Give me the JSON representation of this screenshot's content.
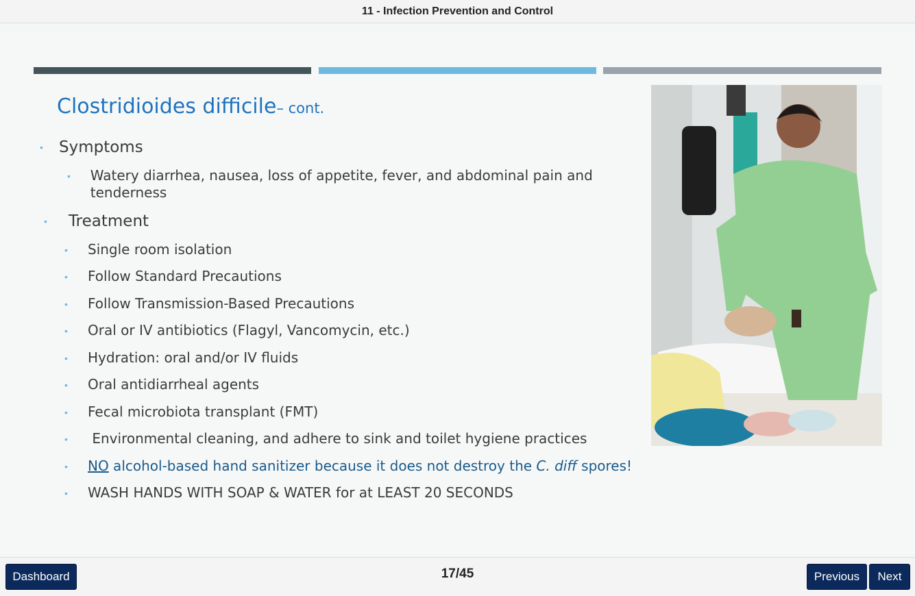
{
  "header": {
    "title": "11 - Infection Prevention and Control"
  },
  "slide": {
    "title": "Clostridioides difficile",
    "title_suffix": "– cont.",
    "sections": [
      {
        "label": "Symptoms",
        "items": [
          "Watery diarrhea, nausea, loss of appetite, fever, and abdominal pain and tenderness"
        ]
      },
      {
        "label": "Treatment",
        "items": [
          "Single room isolation",
          "Follow Standard Precautions",
          "Follow Transmission-Based Precautions",
          "Oral or IV antibiotics (Flagyl, Vancomycin, etc.)",
          "Hydration: oral and/or IV fluids",
          "Oral antidiarrheal agents",
          "Fecal microbiota transplant (FMT)",
          " Environmental cleaning, and adhere to sink and toilet hygiene practices"
        ]
      }
    ],
    "highlight": {
      "no": "NO",
      "middle": " alcohol-based hand sanitizer because it does not destroy the ",
      "italic": "C. diff",
      "end": " spores!"
    },
    "last_item": "WASH HANDS WITH SOAP & WATER for at LEAST 20 SECONDS",
    "photo_description": "Nurse in green scrubs washing hands at sink"
  },
  "footer": {
    "dashboard_label": "Dashboard",
    "page_indicator": "17/45",
    "previous_label": "Previous",
    "next_label": "Next"
  },
  "colors": {
    "title_blue": "#1e73be",
    "bullet_blue": "#6fb9e0",
    "button_navy": "#0b2a5b",
    "stripe_dark": "#44545b",
    "stripe_light_blue": "#6fb9e0",
    "stripe_gray": "#9aa3ab"
  }
}
